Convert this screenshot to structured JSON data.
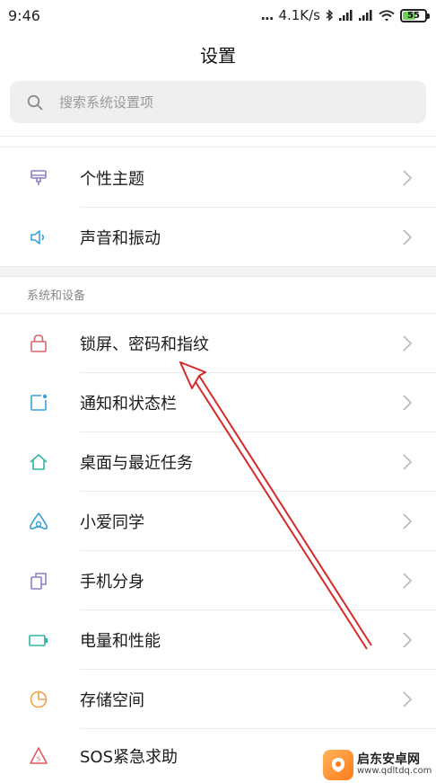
{
  "status_bar": {
    "time": "9:46",
    "network_speed": "4.1K/s",
    "battery_level": "55",
    "battery_fraction": 0.55,
    "signal_dots": "..."
  },
  "header": {
    "title": "设置"
  },
  "search": {
    "placeholder": "搜索系统设置项"
  },
  "sections": {
    "personal": {
      "items": [
        {
          "label": "个性主题",
          "icon": "theme-brush-icon",
          "color": "#8b7ec8"
        },
        {
          "label": "声音和振动",
          "icon": "speaker-icon",
          "color": "#3a9fd8"
        }
      ]
    },
    "system": {
      "title": "系统和设备",
      "items": [
        {
          "label": "锁屏、密码和指纹",
          "icon": "lock-icon",
          "color": "#d9646a"
        },
        {
          "label": "通知和状态栏",
          "icon": "notification-icon",
          "color": "#3a9fd8"
        },
        {
          "label": "桌面与最近任务",
          "icon": "home-icon",
          "color": "#2fb5a6"
        },
        {
          "label": "小爱同学",
          "icon": "xiaoai-assistant-icon",
          "color": "#3a9fd8"
        },
        {
          "label": "手机分身",
          "icon": "dual-copy-icon",
          "color": "#8b7ec8"
        },
        {
          "label": "电量和性能",
          "icon": "battery-icon",
          "color": "#2fb5a6"
        },
        {
          "label": "存储空间",
          "icon": "storage-pie-icon",
          "color": "#f2a14a"
        },
        {
          "label": "SOS紧急求助",
          "icon": "sos-icon",
          "color": "#e05a5a"
        }
      ]
    }
  },
  "watermark": {
    "title": "启东安卓网",
    "url": "www.qdltdq.com"
  },
  "colors": {
    "annotation_arrow": "#d42a2a",
    "chevron": "#b8b8b8",
    "search_bg": "#efefef"
  }
}
